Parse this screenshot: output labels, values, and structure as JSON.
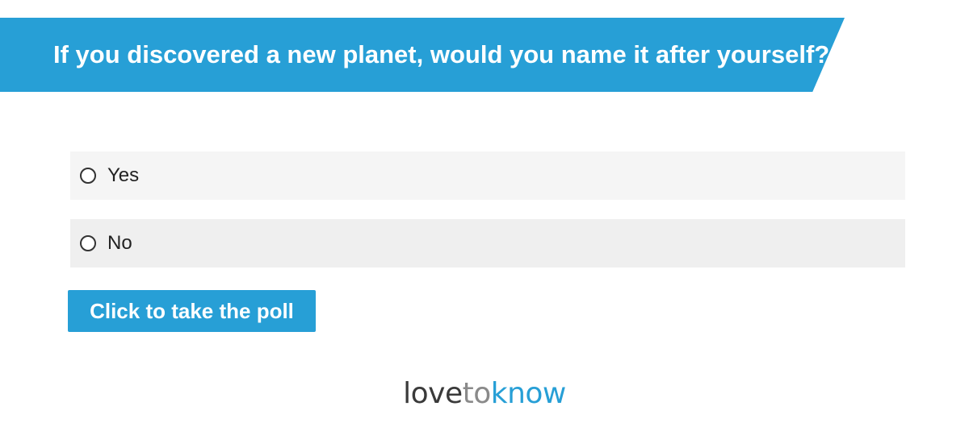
{
  "poll": {
    "question": "If you discovered a new planet, would you name it after yourself?",
    "options": [
      {
        "label": "Yes"
      },
      {
        "label": "No"
      }
    ],
    "submit_label": "Click to take the poll"
  },
  "logo": {
    "part1": "love",
    "part2": "to",
    "part3": "know"
  },
  "colors": {
    "accent": "#279fd6",
    "option_bg_1": "#f5f5f5",
    "option_bg_2": "#efefef",
    "logo_dark": "#3a3a3a",
    "logo_gray": "#8a8a8a"
  },
  "icons": {
    "radio": "radio-unchecked-icon"
  }
}
